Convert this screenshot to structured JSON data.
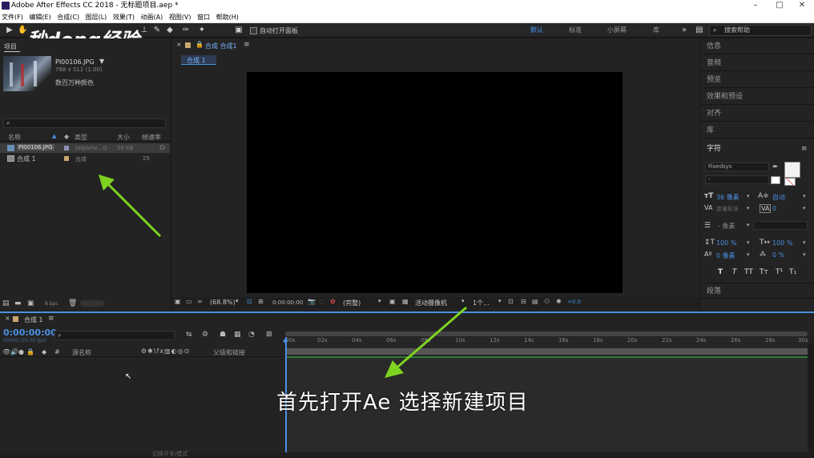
{
  "window": {
    "title": "Adobe After Effects CC 2018 - 无标题项目.aep *"
  },
  "menu": [
    "文件(F)",
    "编辑(E)",
    "合成(C)",
    "图层(L)",
    "效果(T)",
    "动画(A)",
    "视图(V)",
    "窗口",
    "帮助(H)"
  ],
  "toolbar": {
    "auto_open": "自动打开面板",
    "workspaces": [
      "默认",
      "标准",
      "小屏幕",
      "库"
    ],
    "search_help": "搜索帮助"
  },
  "watermark": "秒dong经验",
  "project": {
    "tab": "项目",
    "thumb_name": "PI00106.JPG",
    "thumb_dims": "768 x 512 (1.00)",
    "thumb_colors": "数百万种颜色",
    "columns": [
      "名称",
      "类型",
      "大小",
      "帧速率"
    ],
    "items": [
      {
        "name": "PI00106.JPG",
        "type": "Importe...G",
        "size": "58 KB",
        "fps": ""
      },
      {
        "name": "合成 1",
        "type": "合成",
        "size": "",
        "fps": "25"
      }
    ],
    "bpc": "8 bpc"
  },
  "viewer": {
    "tab": "合成 合成1",
    "comp_tab": "合成 1",
    "zoom": "(68.8%)",
    "time": "0:00:00:00",
    "quality": "(完整)",
    "camera": "活动摄像机",
    "views": "1个...",
    "exposure": "+0.0"
  },
  "right_panels": [
    "信息",
    "音频",
    "预览",
    "效果和预设",
    "对齐",
    "库"
  ],
  "character": {
    "title": "字符",
    "font": "Fixedsys",
    "style": "-",
    "size": "36 像素",
    "leading": "自动",
    "kerning": "度量标准",
    "tracking": "0",
    "stroke": "- 像素",
    "vscale": "100 %",
    "hscale": "100 %",
    "baseline": "0 像素",
    "tsume": "0 %",
    "styles": [
      "T",
      "T",
      "TT",
      "Tт",
      "T¹",
      "T₁"
    ],
    "paragraph": "段落"
  },
  "timeline": {
    "tab": "合成 1",
    "timecode": "0:00:00:00",
    "frame": "00000 (25.00 fps)",
    "col_source": "源名称",
    "col_parent": "父级和链接",
    "ruler": [
      "00s",
      "02s",
      "04s",
      "06s",
      "08s",
      "10s",
      "12s",
      "14s",
      "16s",
      "18s",
      "20s",
      "22s",
      "24s",
      "26s",
      "28s",
      "30s"
    ],
    "bottom": "切换开关/模式"
  },
  "caption": "首先打开Ae   选择新建项目"
}
